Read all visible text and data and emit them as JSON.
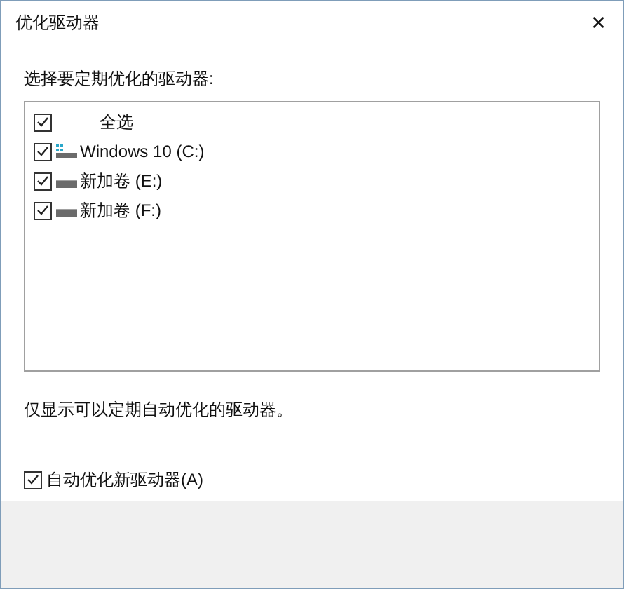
{
  "window": {
    "title": "优化驱动器",
    "close": "×"
  },
  "prompt": "选择要定期优化的驱动器:",
  "drives": [
    {
      "kind": "all",
      "label": "全选",
      "checked": true
    },
    {
      "kind": "system",
      "label": "Windows 10 (C:)",
      "checked": true
    },
    {
      "kind": "data",
      "label": "新加卷 (E:)",
      "checked": true
    },
    {
      "kind": "data",
      "label": "新加卷 (F:)",
      "checked": true
    }
  ],
  "note": "仅显示可以定期自动优化的驱动器。",
  "auto_optimize": {
    "label": "自动优化新驱动器(A)",
    "checked": true
  }
}
